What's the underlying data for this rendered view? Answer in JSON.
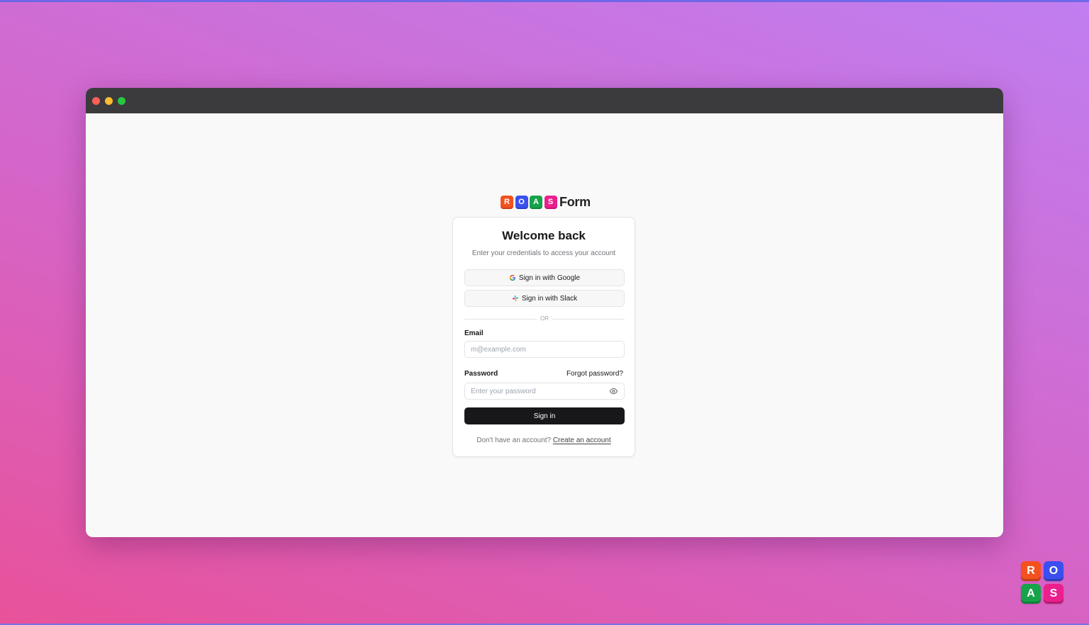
{
  "brand": {
    "tiles": [
      {
        "letter": "R",
        "color": "#f4511e"
      },
      {
        "letter": "O",
        "color": "#3b4ff0"
      },
      {
        "letter": "A",
        "color": "#16a34a"
      },
      {
        "letter": "S",
        "color": "#ec1f8e"
      }
    ],
    "word": "Form"
  },
  "window": {
    "traffic_lights": [
      "#fe5f57",
      "#febc2e",
      "#28c840"
    ]
  },
  "login": {
    "title": "Welcome back",
    "subtitle": "Enter your credentials to access your account",
    "google_button": "Sign in with Google",
    "slack_button": "Sign in with Slack",
    "divider": "OR",
    "email_label": "Email",
    "email_placeholder": "m@example.com",
    "email_value": "",
    "password_label": "Password",
    "forgot_link": "Forgot password?",
    "password_placeholder": "Enter your password",
    "password_value": "",
    "submit_label": "Sign in",
    "footer_text": "Don't have an account?",
    "create_link": "Create an account"
  },
  "colors": {
    "primary_button": "#18181b",
    "card_border": "#e4e4e7"
  }
}
